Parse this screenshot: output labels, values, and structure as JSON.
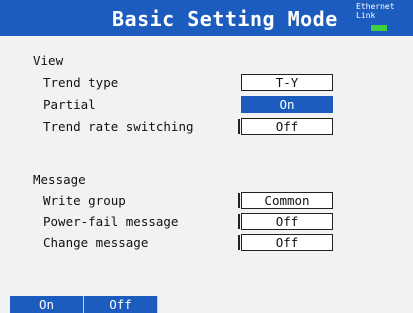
{
  "header": {
    "title": "Basic Setting Mode",
    "ethernet_label": "Ethernet",
    "link_label": "Link",
    "link_color": "#3fd03f"
  },
  "view": {
    "heading": "View",
    "trend_type": {
      "label": "Trend type",
      "value": "T-Y"
    },
    "partial": {
      "label": "Partial",
      "value": "On"
    },
    "trend_rate": {
      "label": "Trend rate switching",
      "value": "Off"
    }
  },
  "message": {
    "heading": "Message",
    "write_group": {
      "label": "Write group",
      "value": "Common"
    },
    "power_fail": {
      "label": "Power-fail message",
      "value": "Off"
    },
    "change": {
      "label": "Change message",
      "value": "Off"
    }
  },
  "softkeys": [
    "On",
    "Off"
  ],
  "colors": {
    "accent": "#1c5cbe",
    "background": "#f2f2f2"
  }
}
